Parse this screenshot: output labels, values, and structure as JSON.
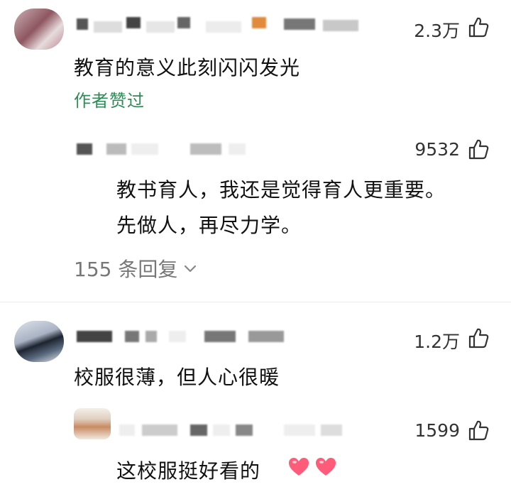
{
  "comments": [
    {
      "likes": "2.3万",
      "text": "教育的意义此刻闪闪发光",
      "author_liked": "作者赞过",
      "reply": {
        "likes": "9532",
        "lines": [
          "教书育人，我还是觉得育人更重要。",
          "先做人，再尽力学。"
        ]
      },
      "replies_toggle": "155 条回复"
    },
    {
      "likes": "1.2万",
      "text": "校服很薄，但人心很暖",
      "reply": {
        "likes": "1599",
        "lines": [
          "这校服挺好看的"
        ]
      }
    }
  ],
  "icons": {
    "like": "thumbs-up-icon",
    "expand": "chevron-down-icon",
    "heart": "heart-emoji"
  },
  "colors": {
    "author_liked": "#2e8b57",
    "heart": "#ff5c7a"
  }
}
